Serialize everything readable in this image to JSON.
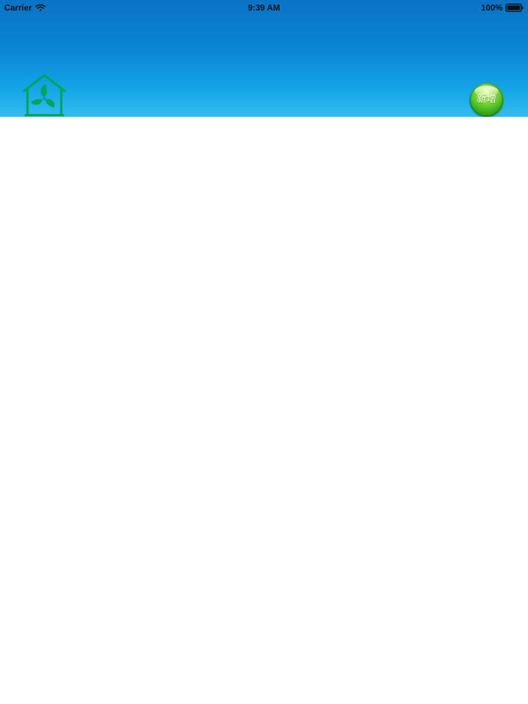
{
  "status_bar": {
    "carrier": "Carrier",
    "time": "9:39 AM",
    "battery": "100%",
    "wifi_icon": "wifi-icon",
    "battery_icon": "battery-icon"
  },
  "header": {
    "home_icon": "home-icon",
    "home_icon_color": "#00a651",
    "add_button_label": "新增",
    "add_button_color": "#4fbf24"
  },
  "main": {
    "background": "#ffffff"
  }
}
